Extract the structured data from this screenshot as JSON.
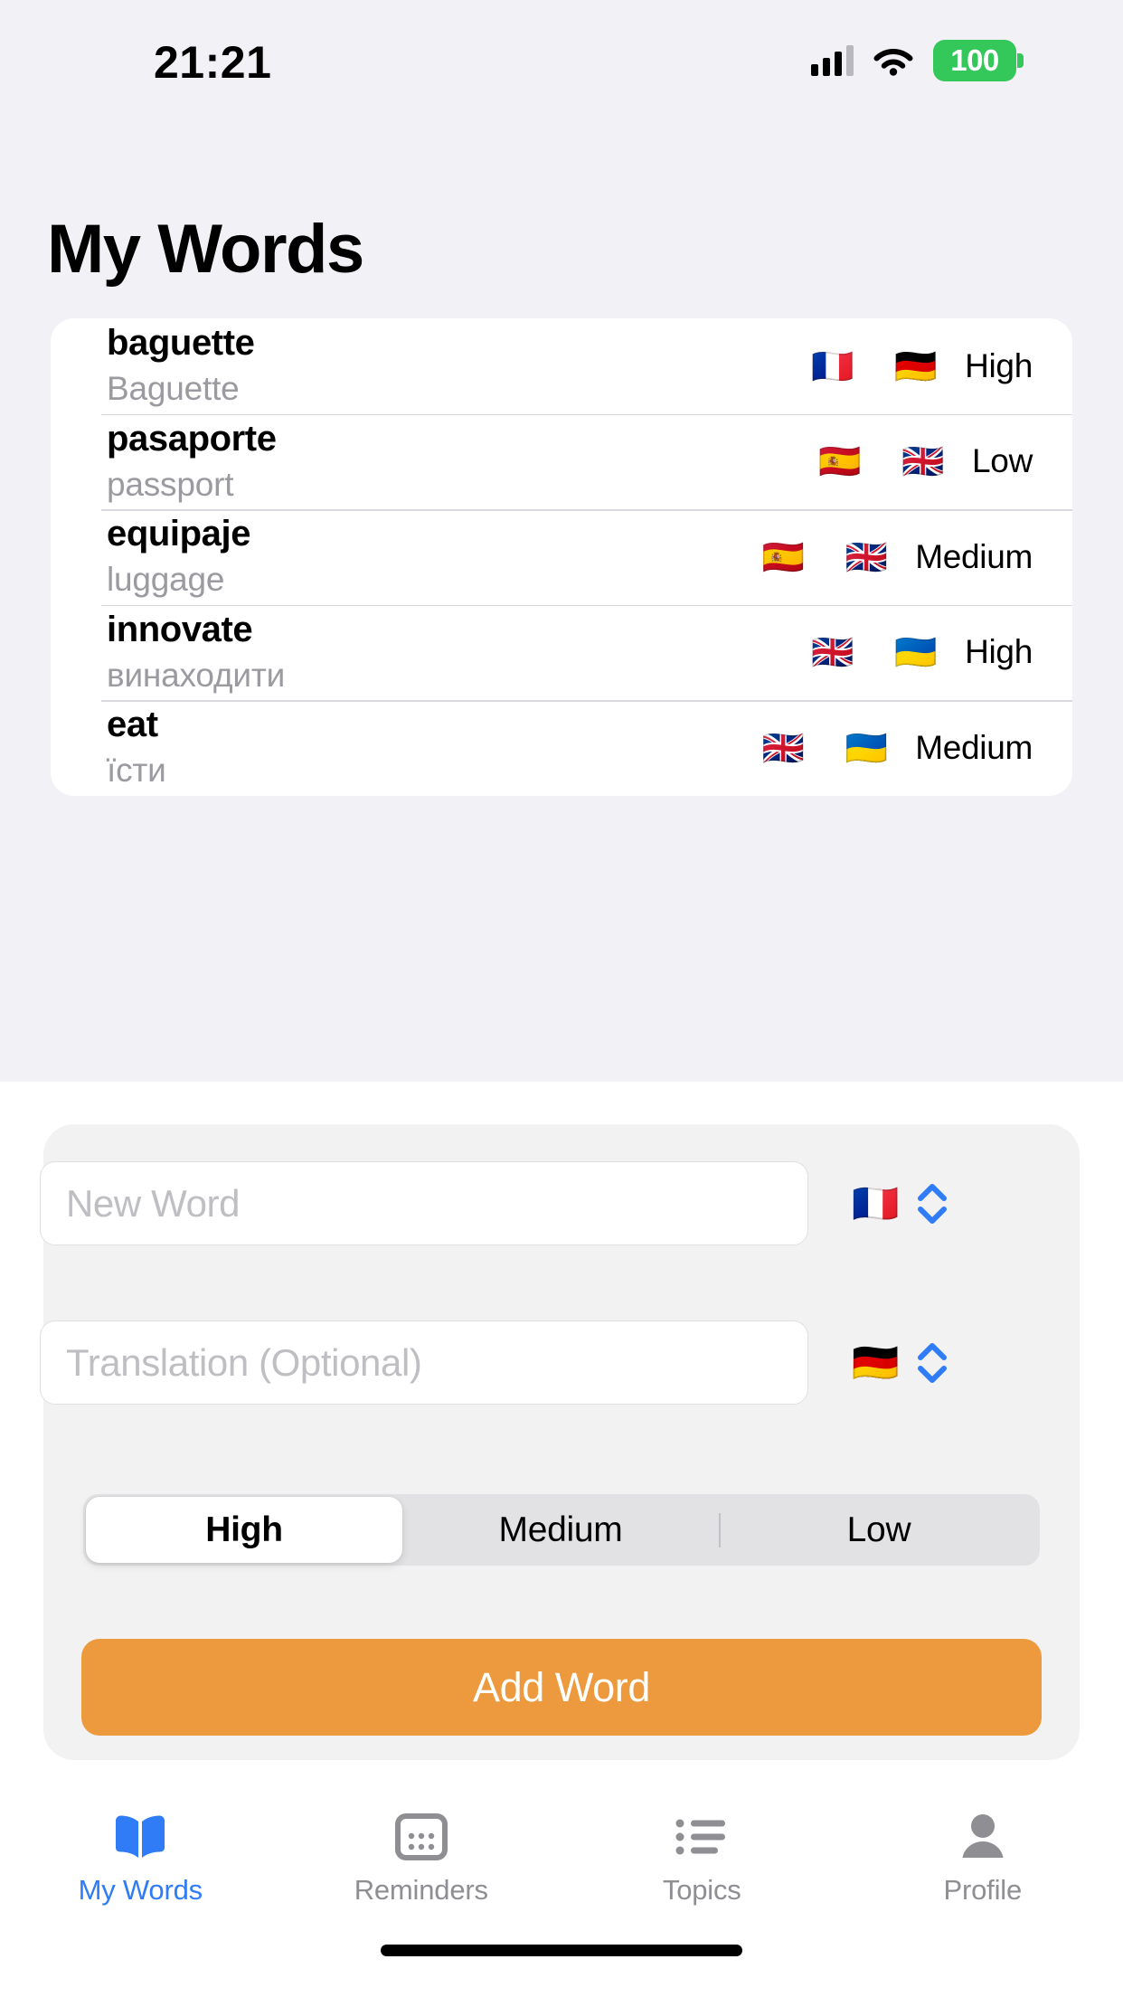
{
  "status_bar": {
    "time": "21:21",
    "battery_percent": "100",
    "icons": [
      "cellular-signal-icon",
      "wifi-icon",
      "battery-icon"
    ]
  },
  "header": {
    "title": "My Words"
  },
  "word_list": {
    "rows": [
      {
        "term": "baguette",
        "translation": "Baguette",
        "source_flag": "🇫🇷",
        "target_flag": "🇩🇪",
        "priority": "High"
      },
      {
        "term": "pasaporte",
        "translation": "passport",
        "source_flag": "🇪🇸",
        "target_flag": "🇬🇧",
        "priority": "Low"
      },
      {
        "term": "equipaje",
        "translation": "luggage",
        "source_flag": "🇪🇸",
        "target_flag": "🇬🇧",
        "priority": "Medium"
      },
      {
        "term": "innovate",
        "translation": "винаходити",
        "source_flag": "🇬🇧",
        "target_flag": "🇺🇦",
        "priority": "High"
      },
      {
        "term": "eat",
        "translation": "їсти",
        "source_flag": "🇬🇧",
        "target_flag": "🇺🇦",
        "priority": "Medium"
      }
    ]
  },
  "add_form": {
    "word_input": {
      "value": "",
      "placeholder": "New Word",
      "language_flag": "🇫🇷"
    },
    "translation_input": {
      "value": "",
      "placeholder": "Translation (Optional)",
      "language_flag": "🇩🇪"
    },
    "priority_segments": [
      {
        "label": "High",
        "selected": true
      },
      {
        "label": "Medium",
        "selected": false
      },
      {
        "label": "Low",
        "selected": false
      }
    ],
    "submit_label": "Add Word",
    "submit_color": "#ED9A3E"
  },
  "tab_bar": {
    "active_color": "#2F7CF6",
    "inactive_color": "#8E8E93",
    "tabs": [
      {
        "label": "My Words",
        "icon": "book-icon",
        "active": true
      },
      {
        "label": "Reminders",
        "icon": "calendar-icon",
        "active": false
      },
      {
        "label": "Topics",
        "icon": "bullet-list-icon",
        "active": false
      },
      {
        "label": "Profile",
        "icon": "person-icon",
        "active": false
      }
    ]
  }
}
